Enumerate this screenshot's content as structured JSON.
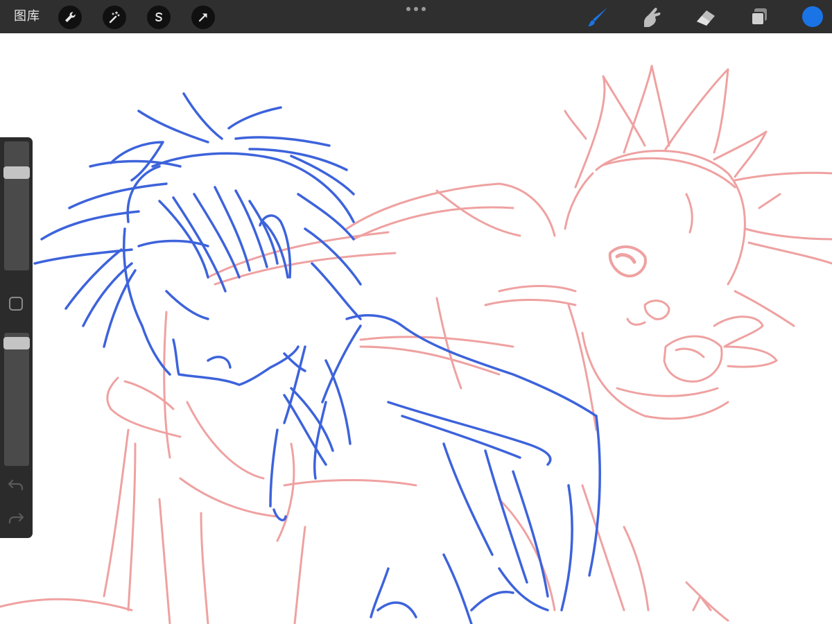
{
  "app": {
    "gallery_label": "图库"
  },
  "toolbar_left": [
    {
      "name": "actions-button",
      "icon": "wrench-icon"
    },
    {
      "name": "adjustments-button",
      "icon": "magic-wand-icon"
    },
    {
      "name": "selection-button",
      "icon": "selection-s-icon"
    },
    {
      "name": "transform-button",
      "icon": "arrow-cursor-icon"
    }
  ],
  "toolbar_center": {
    "icon": "more-dots-icon"
  },
  "toolbar_right": [
    {
      "name": "brush-tool",
      "icon": "brush-icon",
      "active": true,
      "color": "#1a74e6"
    },
    {
      "name": "smudge-tool",
      "icon": "smudge-finger-icon",
      "active": false
    },
    {
      "name": "eraser-tool",
      "icon": "eraser-icon",
      "active": false
    },
    {
      "name": "layers-button",
      "icon": "layers-icon",
      "active": false
    }
  ],
  "current_color": "#1a74e6",
  "sidebar": {
    "brush_size_level": 0.78,
    "opacity_level": 0.96,
    "undo_icon": "undo-icon",
    "redo_icon": "redo-icon",
    "modifier_icon": "square-modifier-icon"
  },
  "canvas": {
    "sketch_colors": {
      "blue": "#3d63db",
      "red": "#ef9c9c"
    }
  }
}
